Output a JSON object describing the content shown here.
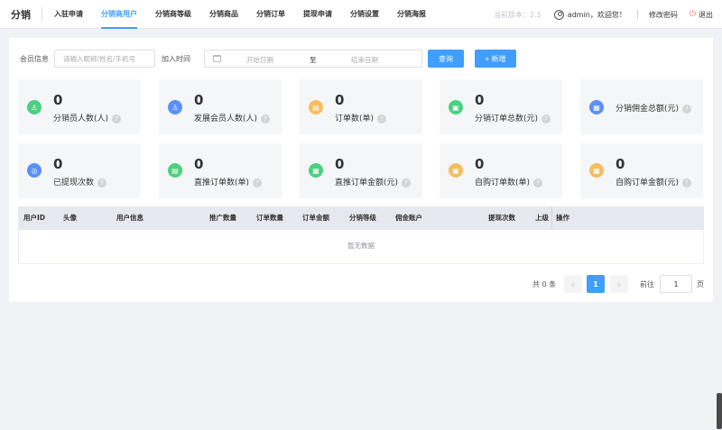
{
  "header": {
    "logo": "分销",
    "nav": [
      "入驻申请",
      "分销商用户",
      "分销商等级",
      "分销商品",
      "分销订单",
      "提现申请",
      "分销设置",
      "分销海报"
    ],
    "active_index": 1,
    "version": "当前版本：2.5",
    "user": "admin，欢迎您！",
    "change_password": "修改密码",
    "logout": "退出"
  },
  "filter": {
    "member_label": "会员信息",
    "member_placeholder": "请输入昵称/姓名/手机号",
    "join_time_label": "加入时间",
    "start_placeholder": "开始日期",
    "to": "至",
    "end_placeholder": "结束日期",
    "query_button": "查询",
    "add_button": "+ 新增"
  },
  "stats": [
    {
      "value": "0",
      "label": "分销员人数(人)",
      "icon": "user-icon",
      "color": "#4cd080"
    },
    {
      "value": "0",
      "label": "发展会员人数(人)",
      "icon": "users-icon",
      "color": "#5b8ff9"
    },
    {
      "value": "0",
      "label": "订单数(单)",
      "icon": "order-icon",
      "color": "#f6bd60"
    },
    {
      "value": "0",
      "label": "分销订单总数(元)",
      "icon": "wallet-icon",
      "color": "#4cd080"
    },
    {
      "value": "",
      "label": "分销佣金总额(元)",
      "icon": "commission-icon",
      "color": "#5b8ff9"
    },
    {
      "value": "0",
      "label": "已提现次数",
      "icon": "withdraw-icon",
      "color": "#5b8ff9"
    },
    {
      "value": "0",
      "label": "直推订单数(单)",
      "icon": "direct-order-icon",
      "color": "#4cd080"
    },
    {
      "value": "0",
      "label": "直推订单金额(元)",
      "icon": "direct-amount-icon",
      "color": "#4cd080"
    },
    {
      "value": "0",
      "label": "自购订单数(单)",
      "icon": "self-order-icon",
      "color": "#f6bd60"
    },
    {
      "value": "0",
      "label": "自购订单金额(元)",
      "icon": "self-amount-icon",
      "color": "#f6bd60"
    }
  ],
  "table": {
    "columns": [
      "用户ID",
      "头像",
      "用户信息",
      "推广数量",
      "订单数量",
      "订单金额",
      "分销等级",
      "佣金账户",
      "提现次数",
      "上级",
      "操作"
    ],
    "empty_text": "暂无数据"
  },
  "pagination": {
    "total": "共 0 条",
    "prev": "‹",
    "current": "1",
    "next": "›",
    "goto": "前往",
    "page_input": "1",
    "page_unit": "页"
  }
}
